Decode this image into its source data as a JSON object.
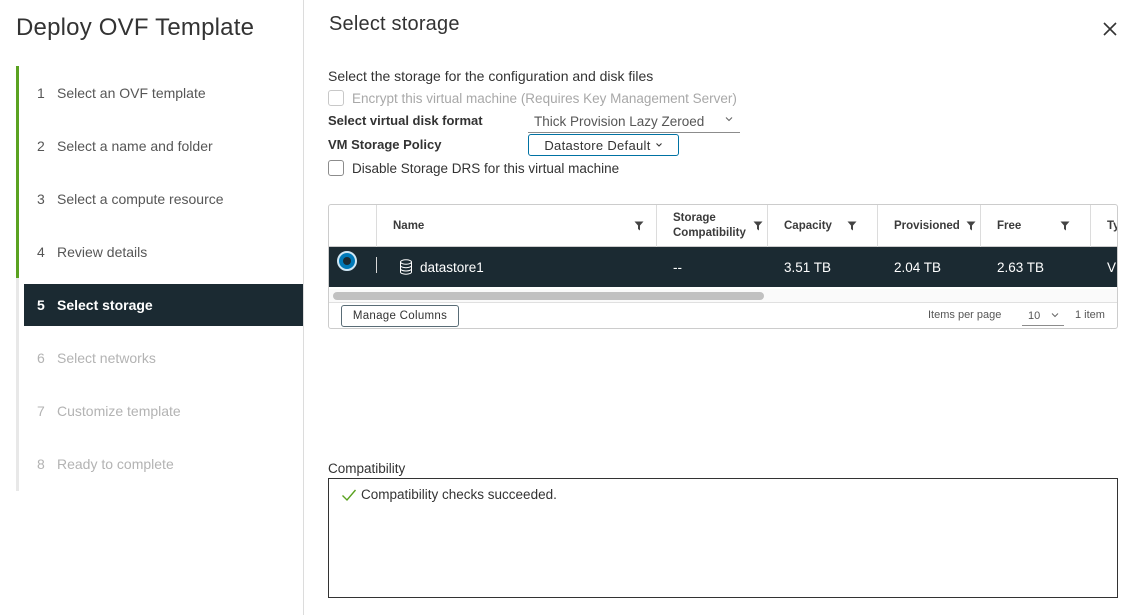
{
  "wizard": {
    "title": "Deploy OVF Template",
    "steps": [
      {
        "num": "1",
        "label": "Select an OVF template"
      },
      {
        "num": "2",
        "label": "Select a name and folder"
      },
      {
        "num": "3",
        "label": "Select a compute resource"
      },
      {
        "num": "4",
        "label": "Review details"
      },
      {
        "num": "5",
        "label": "Select storage"
      },
      {
        "num": "6",
        "label": "Select networks"
      },
      {
        "num": "7",
        "label": "Customize template"
      },
      {
        "num": "8",
        "label": "Ready to complete"
      }
    ]
  },
  "page": {
    "title": "Select storage",
    "description": "Select the storage for the configuration and disk files",
    "encrypt_label": "Encrypt this virtual machine (Requires Key Management Server)",
    "disk_format_label": "Select virtual disk format",
    "disk_format_value": "Thick Provision Lazy Zeroed",
    "policy_label": "VM Storage Policy",
    "policy_value": "Datastore Default",
    "disable_drs_label": "Disable Storage DRS for this virtual machine"
  },
  "grid": {
    "columns": {
      "name": "Name",
      "compat_line1": "Storage",
      "compat_line2": "Compatibility",
      "capacity": "Capacity",
      "provisioned": "Provisioned",
      "free": "Free",
      "type": "Ty"
    },
    "rows": [
      {
        "name": "datastore1",
        "compatibility": "--",
        "capacity": "3.51 TB",
        "provisioned": "2.04 TB",
        "free": "2.63 TB",
        "type": "V"
      }
    ],
    "manage_columns": "Manage Columns",
    "items_per_page_label": "Items per page",
    "items_per_page_value": "10",
    "item_count": "1 item"
  },
  "compatibility": {
    "label": "Compatibility",
    "message": "Compatibility checks succeeded."
  },
  "colors": {
    "accent": "#0079b8",
    "selected_row": "#1b2a32",
    "completed_step": "#5aa220",
    "success_check": "#5aa220"
  }
}
